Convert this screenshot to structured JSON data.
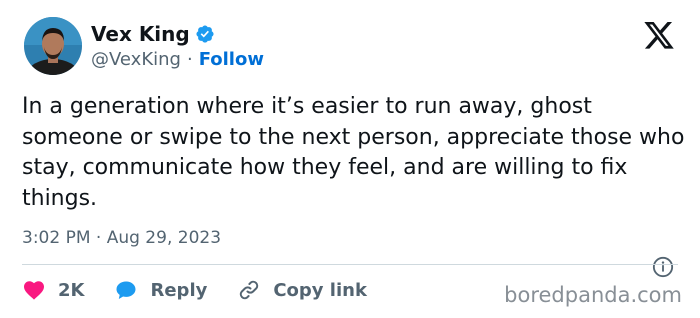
{
  "author": {
    "name": "Vex King",
    "handle": "@VexKing",
    "separator": "·",
    "follow_label": "Follow"
  },
  "tweet": {
    "text": "In a generation where it’s easier to run away, ghost someone or swipe to the next person, appreciate those who stay, communicate how they feel, and are willing to fix things.",
    "timestamp": "3:02 PM · Aug 29, 2023"
  },
  "actions": {
    "like_count": "2K",
    "reply_label": "Reply",
    "copy_link_label": "Copy link"
  },
  "watermark": "boredpanda.com",
  "colors": {
    "text": "#0f1419",
    "secondary": "#536471",
    "follow_blue": "#006fd6",
    "verified_blue": "#1d9bf0",
    "heart": "#f91880",
    "reply_blue": "#1d9bf0"
  },
  "icons": [
    "verified-badge-icon",
    "x-logo-icon",
    "info-icon",
    "heart-icon",
    "reply-bubble-icon",
    "link-icon"
  ]
}
